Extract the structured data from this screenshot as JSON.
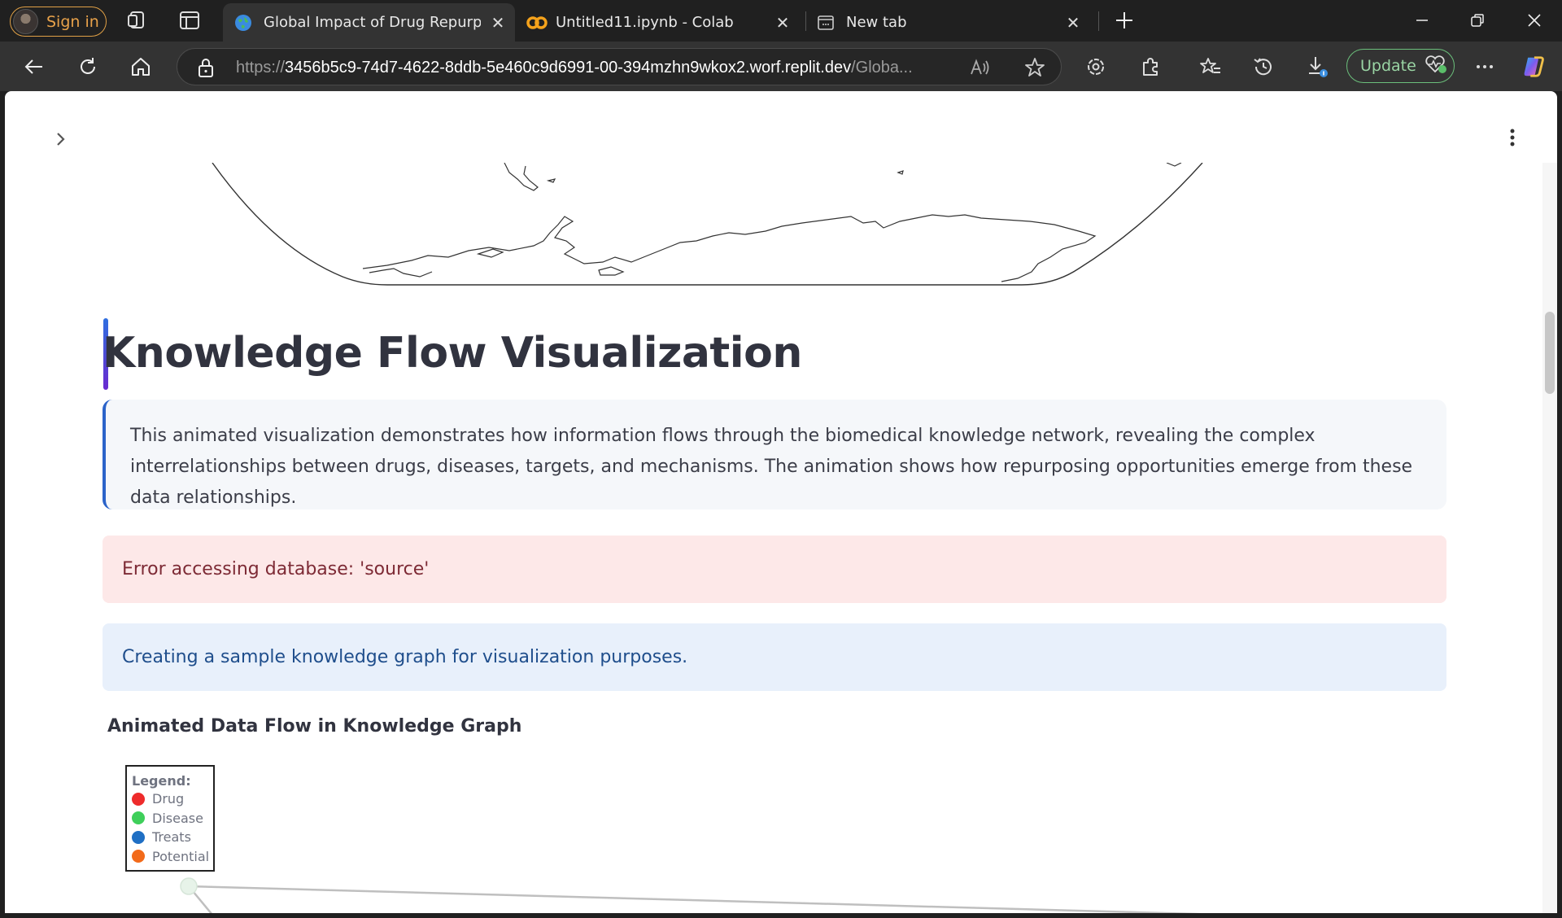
{
  "browser": {
    "sign_in_label": "Sign in",
    "tabs": [
      {
        "title": "Global Impact of Drug Repurposing",
        "active": true,
        "icon": "globe-icon"
      },
      {
        "title": "Untitled11.ipynb - Colab",
        "active": false,
        "icon": "colab-icon"
      },
      {
        "title": "New tab",
        "active": false,
        "icon": "new-tab-page-icon"
      }
    ],
    "url": {
      "protocol": "https://",
      "host": "3456b5c9-74d7-4622-8ddb-5e460c9d6991-00-394mzhn9wkox2.worf.replit.dev",
      "path": "/Globa..."
    },
    "update_label": "Update"
  },
  "page": {
    "heading": "Knowledge Flow Visualization",
    "description": "This animated visualization demonstrates how information flows through the biomedical knowledge network, revealing the complex interrelationships between drugs, diseases, targets, and mechanisms. The animation shows how repurposing opportunities emerge from these data relationships.",
    "error_message": "Error accessing database: 'source'",
    "info_message": "Creating a sample knowledge graph for visualization purposes.",
    "subheading": "Animated Data Flow in Knowledge Graph",
    "legend": {
      "title": "Legend:",
      "items": [
        {
          "label": "Drug",
          "color": "#ee2b2b"
        },
        {
          "label": "Disease",
          "color": "#3ecf5a"
        },
        {
          "label": "Treats",
          "color": "#1f6fc4"
        },
        {
          "label": "Potential",
          "color": "#f26a1a"
        }
      ]
    }
  },
  "colors": {
    "accent_gradient_start": "#2f6fe0",
    "accent_gradient_end": "#6a2ad0",
    "error_bg": "#fde8e8",
    "info_bg": "#e8f0fb"
  }
}
